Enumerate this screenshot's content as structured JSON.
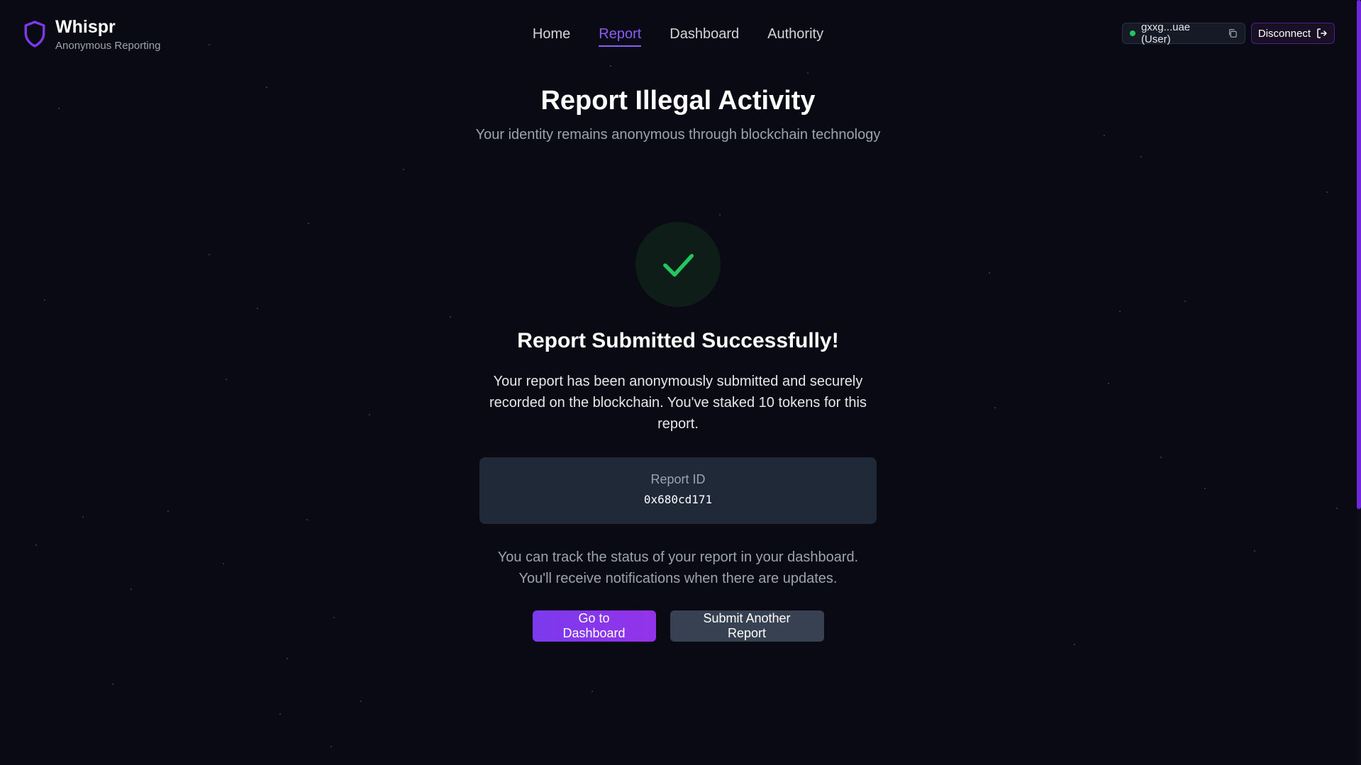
{
  "brand": {
    "name": "Whispr",
    "tagline": "Anonymous Reporting",
    "icon": "shield-icon",
    "accent_color": "#7c3aed"
  },
  "nav": {
    "items": [
      {
        "label": "Home",
        "active": false
      },
      {
        "label": "Report",
        "active": true
      },
      {
        "label": "Dashboard",
        "active": false
      },
      {
        "label": "Authority",
        "active": false
      }
    ]
  },
  "wallet": {
    "address_label": "gxxg...uae (User)",
    "status_color": "#22c55e",
    "copy_icon": "copy-icon"
  },
  "disconnect": {
    "label": "Disconnect",
    "icon": "logout-icon"
  },
  "page": {
    "title": "Report Illegal Activity",
    "subtitle": "Your identity remains anonymous through blockchain technology"
  },
  "success": {
    "icon": "check-icon",
    "icon_color": "#22c55e",
    "title": "Report Submitted Successfully!",
    "description": "Your report has been anonymously submitted and securely recorded on the blockchain. You've staked 10 tokens for this report."
  },
  "report": {
    "id_label": "Report ID",
    "id_value": "0x680cd171"
  },
  "tracking": {
    "text": "You can track the status of your report in your dashboard. You'll receive notifications when there are updates."
  },
  "actions": {
    "primary_label": "Go to Dashboard",
    "secondary_label": "Submit Another Report"
  }
}
